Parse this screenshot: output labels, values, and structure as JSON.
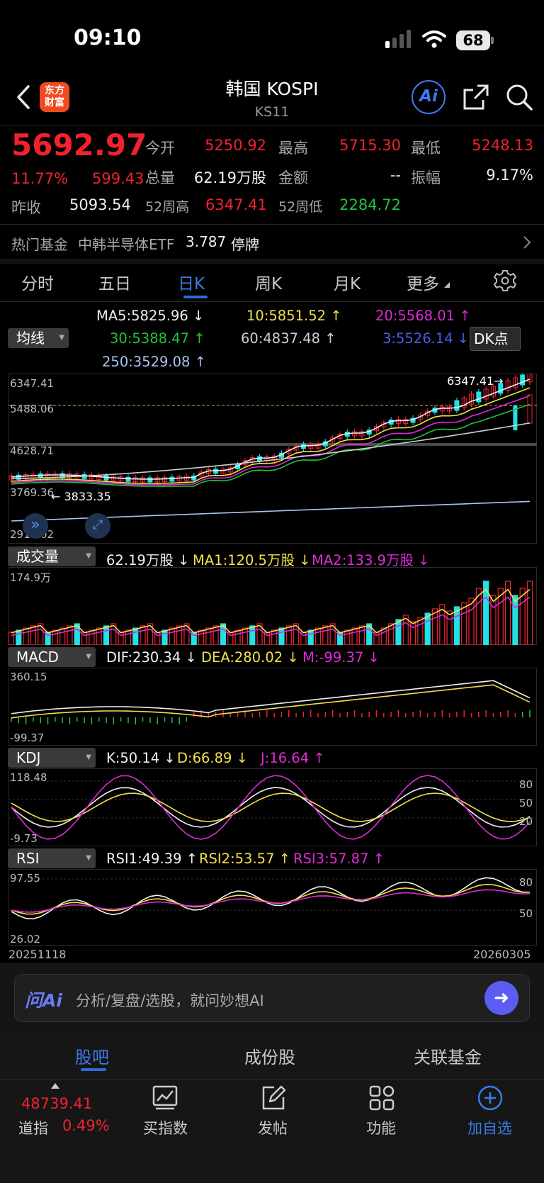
{
  "status_bar": {
    "time": "09:10",
    "battery": "68"
  },
  "header": {
    "title": "韩国 KOSPI",
    "code": "KS11",
    "logo_text": "东方财富",
    "ai_label": "Ai"
  },
  "quote": {
    "price": "5692.97",
    "change_pct": "11.77%",
    "change": "599.43",
    "open_label": "今开",
    "open": "5250.92",
    "high_label": "最高",
    "high": "5715.30",
    "low_label": "最低",
    "low": "5248.13",
    "volume_label": "总量",
    "volume": "62.19万股",
    "amount_label": "金额",
    "amount": "--",
    "amplitude_label": "振幅",
    "amplitude": "9.17%",
    "prev_close_label": "昨收",
    "prev_close": "5093.54",
    "week52_high_label": "52周高",
    "week52_high": "6347.41",
    "week52_low_label": "52周低",
    "week52_low": "2284.72"
  },
  "fund_bar": {
    "label": "热门基金",
    "name": "中韩半导体ETF",
    "value": "3.787",
    "status": "停牌"
  },
  "tabs": [
    "分时",
    "五日",
    "日K",
    "周K",
    "月K",
    "更多"
  ],
  "active_tab": "日K",
  "ma": {
    "selector": "均线",
    "ma5": "MA5:5825.96",
    "ma10": "10:5851.52",
    "ma20": "20:5568.01",
    "ma30": "30:5388.47",
    "ma60": "60:4837.48",
    "ma3": "3:5526.14",
    "ma250": "250:3529.08",
    "dk_button": "DK点"
  },
  "kline": {
    "axis": [
      "6347.41",
      "5488.06",
      "4628.71",
      "3769.36",
      "2910.02"
    ],
    "high_marker": "6347.41",
    "low_marker": "3833.35"
  },
  "volume_panel": {
    "selector": "成交量",
    "volume": "62.19万股",
    "ma1": "MA1:120.5万股",
    "ma2": "MA2:133.9万股",
    "axis_top": "174.9万"
  },
  "macd_panel": {
    "selector": "MACD",
    "dif": "DIF:230.34",
    "dea": "DEA:280.02",
    "m": "M:-99.37",
    "axis_top": "360.15",
    "axis_bottom": "-99.37"
  },
  "kdj_panel": {
    "selector": "KDJ",
    "k": "K:50.14",
    "d": "D:66.89",
    "j": "J:16.64",
    "axis_top": "118.48",
    "axis_bottom": "-9.73",
    "levels": [
      "80",
      "50",
      "20"
    ]
  },
  "rsi_panel": {
    "selector": "RSI",
    "rsi1": "RSI1:49.39",
    "rsi2": "RSI2:53.57",
    "rsi3": "RSI3:57.87",
    "axis_top": "97.55",
    "axis_bottom": "26.02",
    "levels": [
      "80",
      "50"
    ]
  },
  "date_range": {
    "start": "20251118",
    "end": "20260305"
  },
  "ai_input": {
    "logo": "问Ai",
    "placeholder": "分析/复盘/选股，就问妙想AI"
  },
  "bottom_tabs": [
    "股吧",
    "成份股",
    "关联基金"
  ],
  "bottom_nav": {
    "index_value": "48739.41",
    "index_label": "道指",
    "index_change": "0.49%",
    "items": [
      "买指数",
      "发帖",
      "功能",
      "加自选"
    ]
  },
  "colors": {
    "up": "#f2212e",
    "down": "#21e0e6",
    "accent": "#2b6bd6"
  }
}
